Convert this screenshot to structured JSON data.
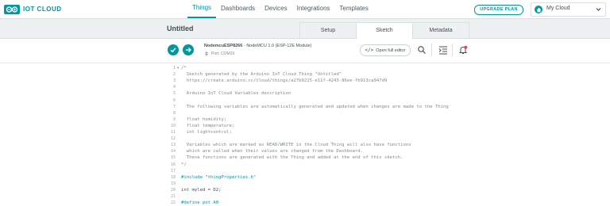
{
  "logo": {
    "text": "IOT CLOUD"
  },
  "nav": [
    "Things",
    "Dashboards",
    "Devices",
    "Integrations",
    "Templates"
  ],
  "upgrade_label": "UPGRADE PLAN",
  "cloud_select": {
    "label": "My Cloud"
  },
  "page_title": "Untitled",
  "tabs": [
    "Setup",
    "Sketch",
    "Metadata"
  ],
  "board": {
    "name": "NodemcuESP8266",
    "model": " - NodeMCU 1.0 (ESP-12E Module)",
    "port": "Port: COM19"
  },
  "open_editor_label": "Open full editor",
  "code_lines": [
    {
      "n": "1",
      "fold": "▾",
      "text": "/*"
    },
    {
      "n": "2",
      "fold": "",
      "text": "  Sketch generated by the Arduino IoT Cloud Thing \"Untitled\""
    },
    {
      "n": "3",
      "fold": "",
      "text": "  https://create.arduino.cc/cloud/things/a27b9215-e11f-4243-86ee-fb913ca947d9"
    },
    {
      "n": "4",
      "fold": "",
      "text": ""
    },
    {
      "n": "5",
      "fold": "",
      "text": "  Arduino IoT Cloud Variables description"
    },
    {
      "n": "6",
      "fold": "",
      "text": ""
    },
    {
      "n": "7",
      "fold": "",
      "text": "  The following variables are automatically generated and updated when changes are made to the Thing"
    },
    {
      "n": "8",
      "fold": "",
      "text": ""
    },
    {
      "n": "9",
      "fold": "",
      "text": "  float humidity;"
    },
    {
      "n": "10",
      "fold": "",
      "text": "  float temperature;"
    },
    {
      "n": "11",
      "fold": "",
      "text": "  int lightcontrol;"
    },
    {
      "n": "12",
      "fold": "",
      "text": ""
    },
    {
      "n": "13",
      "fold": "",
      "text": "  Variables which are marked as READ/WRITE in the Cloud Thing will also have functions"
    },
    {
      "n": "14",
      "fold": "",
      "text": "  which are called when their values are changed from the Dashboard."
    },
    {
      "n": "15",
      "fold": "",
      "text": "  These functions are generated with the Thing and added at the end of this sketch."
    },
    {
      "n": "16",
      "fold": "",
      "text": "*/"
    },
    {
      "n": "17",
      "fold": "",
      "text": ""
    },
    {
      "n": "18",
      "fold": "",
      "text": "#include \"thingProperties.h\""
    },
    {
      "n": "19",
      "fold": "",
      "text": ""
    },
    {
      "n": "20",
      "fold": "",
      "text": "int myled = D2;"
    },
    {
      "n": "21",
      "fold": "",
      "text": ""
    },
    {
      "n": "22",
      "fold": "",
      "text": "#define pot A0"
    }
  ],
  "colors": {
    "accent": "#00979d",
    "text": "#434f54",
    "comment": "#7f8c8d",
    "alert": "#e44a4a"
  }
}
